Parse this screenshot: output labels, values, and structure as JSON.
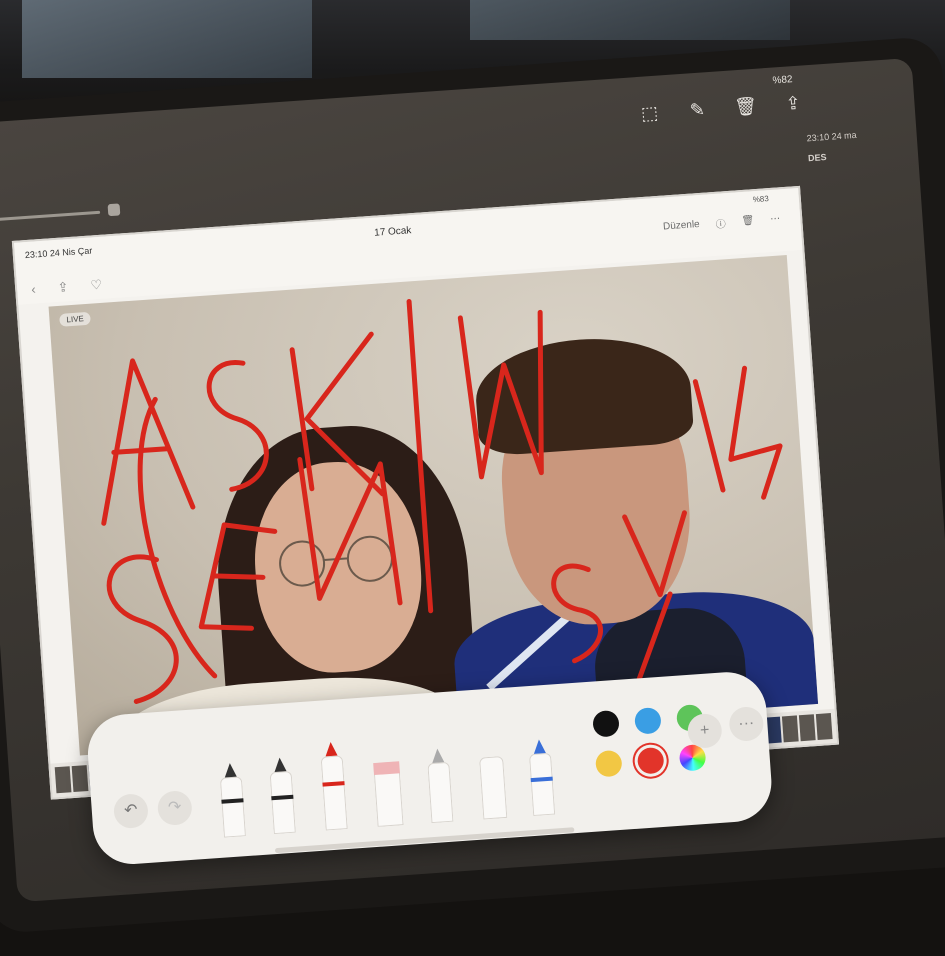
{
  "outer": {
    "status": "%82",
    "tools": [
      {
        "icon": "select-icon"
      },
      {
        "icon": "markup-pen-icon"
      },
      {
        "icon": "trash-icon"
      },
      {
        "icon": "share-icon"
      }
    ],
    "side_time": "23:10 24 ma",
    "side_label": "DES"
  },
  "inner": {
    "time": "23:10 24 Nis Çar",
    "status": "%83",
    "title": "17 Ocak",
    "edit_label": "Düzenle",
    "live_label": "LIVE"
  },
  "drawing": {
    "color": "#d8261c",
    "text_top": "AŞKIM",
    "text_left": "SENİ",
    "text_right": "SEVİYORUM"
  },
  "toolbar": {
    "undo_icon": "undo-icon",
    "redo_icon": "redo-icon",
    "tools": [
      "pen",
      "monoline",
      "marker",
      "eraser",
      "lasso",
      "ruler",
      "fountain-pen"
    ],
    "colors": [
      "#111111",
      "#3a9ee4",
      "#5ec45a",
      "#f2c744",
      "#e2342a",
      "color-wheel"
    ],
    "selected_color": "#e2342a",
    "add_label": "+",
    "more_label": "···"
  }
}
